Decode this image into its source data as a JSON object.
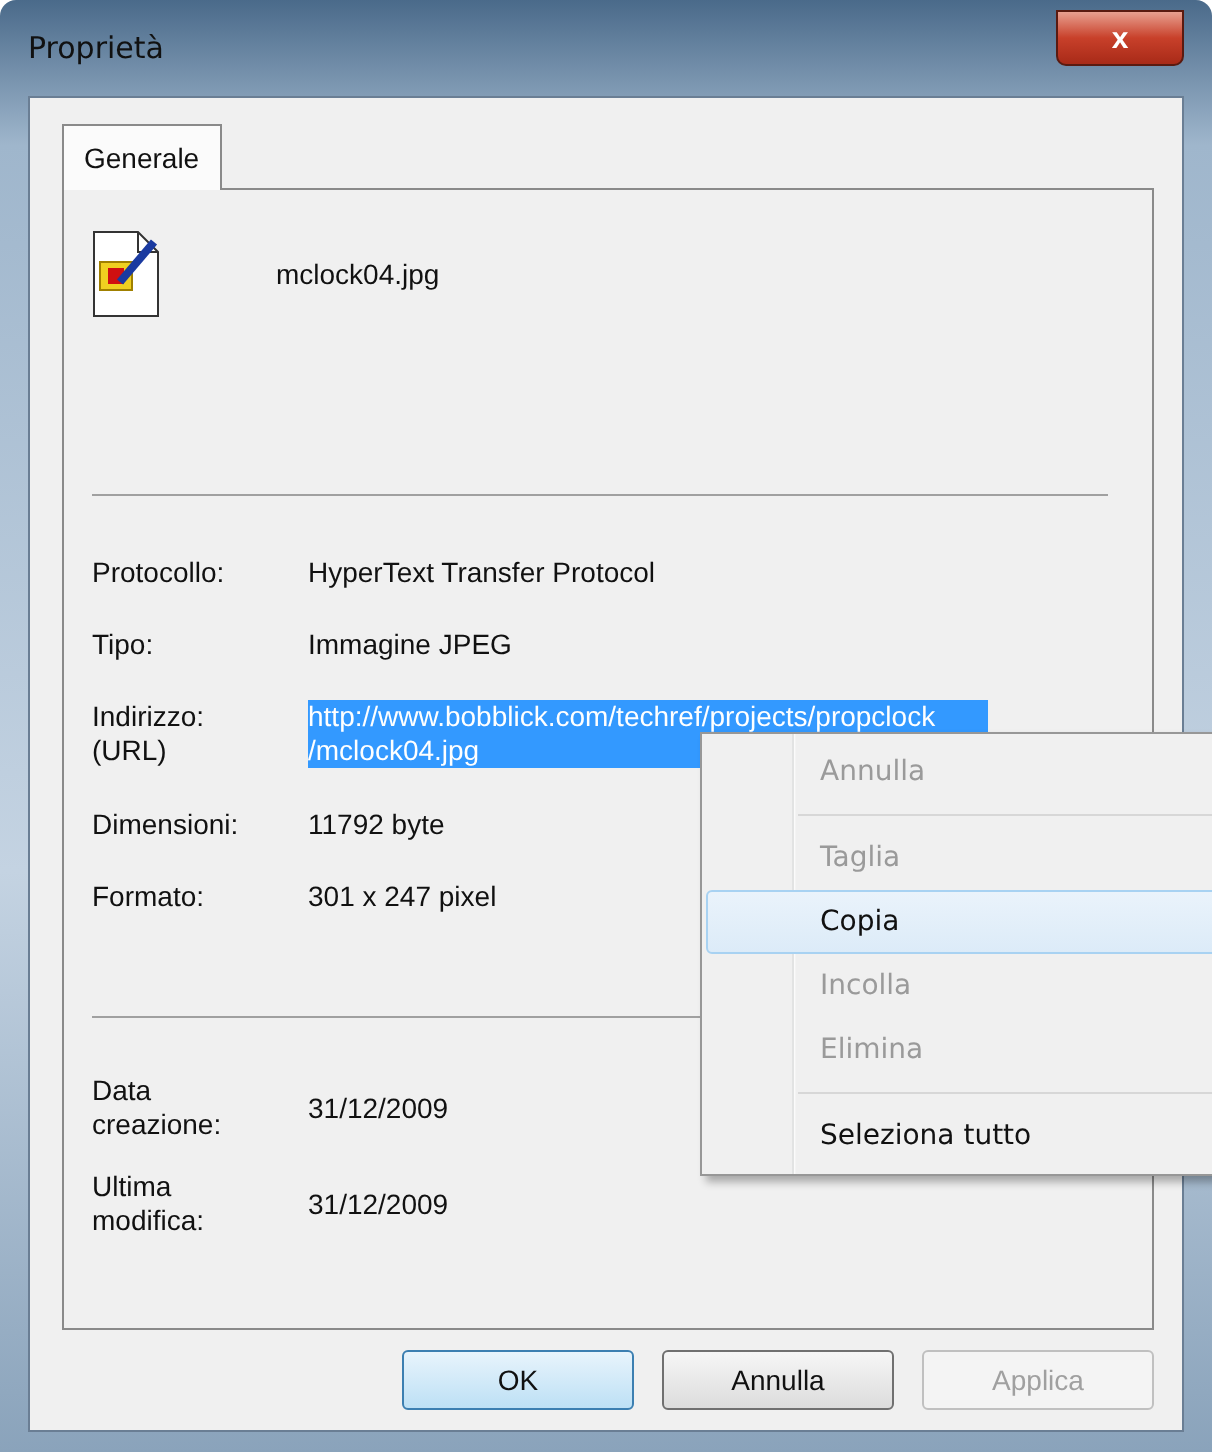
{
  "window": {
    "title": "Proprietà",
    "close": "x"
  },
  "tabs": [
    {
      "label": "Generale",
      "selected": true
    }
  ],
  "file": {
    "name": "mclock04.jpg"
  },
  "properties": [
    {
      "label": "Protocollo:",
      "value": "HyperText Transfer Protocol"
    },
    {
      "label": "Tipo:",
      "value": "Immagine JPEG"
    },
    {
      "label": "Indirizzo: (URL)",
      "value": "http://www.bobblick.com/techref/projects/propclock /mclock04.jpg",
      "kind": "selected-text"
    },
    {
      "label": "Dimensioni:",
      "value": "11792 byte"
    },
    {
      "label": "Formato:",
      "value": "301  x  247  pixel"
    }
  ],
  "dates": [
    {
      "label": "Data creazione:",
      "value": "31/12/2009"
    },
    {
      "label": "Ultima modifica:",
      "value": "31/12/2009"
    }
  ],
  "buttons": [
    {
      "label": "OK",
      "default": true,
      "disabled": false
    },
    {
      "label": "Annulla",
      "default": false,
      "disabled": false
    },
    {
      "label": "Applica",
      "default": false,
      "disabled": true
    }
  ],
  "context_menu": [
    {
      "label": "Annulla",
      "disabled": true,
      "selected": false
    },
    {
      "kind": "separator"
    },
    {
      "label": "Taglia",
      "disabled": true,
      "selected": false
    },
    {
      "label": "Copia",
      "disabled": false,
      "selected": true
    },
    {
      "label": "Incolla",
      "disabled": true,
      "selected": false
    },
    {
      "label": "Elimina",
      "disabled": true,
      "selected": false
    },
    {
      "kind": "separator"
    },
    {
      "label": "Seleziona tutto",
      "disabled": false,
      "selected": false
    }
  ]
}
